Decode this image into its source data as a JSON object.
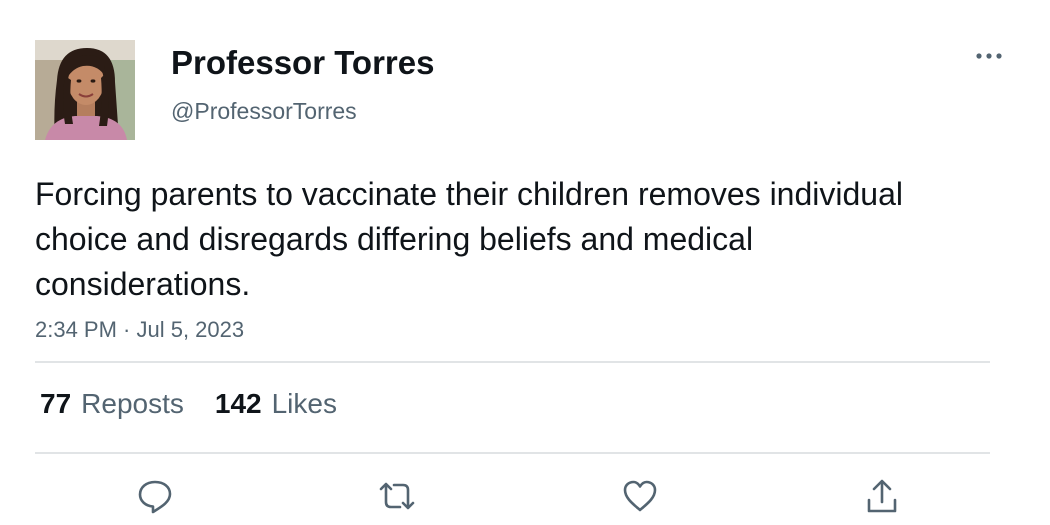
{
  "author": {
    "display_name": "Professor Torres",
    "handle": "@ProfessorTorres"
  },
  "tweet": {
    "text": "Forcing parents to vaccinate their children removes individual choice and disregards differing beliefs and medical considerations.",
    "timestamp": "2:34 PM · Jul 5, 2023"
  },
  "stats": {
    "reposts_count": "77",
    "reposts_label": "Reposts",
    "likes_count": "142",
    "likes_label": "Likes"
  },
  "icons": {
    "more": "more-horizontal-icon",
    "reply": "reply-icon",
    "repost": "repost-icon",
    "like": "heart-icon",
    "share": "share-icon"
  },
  "colors": {
    "text_primary": "#0f1419",
    "text_secondary": "#536471",
    "divider": "#e1e4e6",
    "icon": "#536471"
  }
}
